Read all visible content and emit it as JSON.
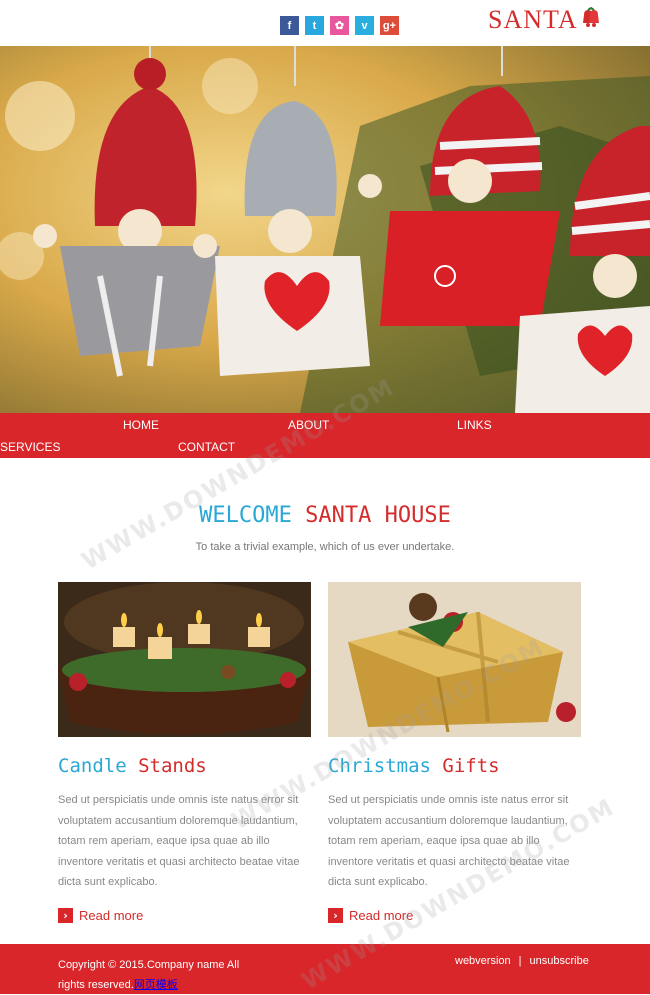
{
  "colors": {
    "accent_red": "#d8262a",
    "accent_blue": "#29a8d6"
  },
  "social": [
    {
      "icon": "facebook-icon",
      "glyph": "f",
      "color": "#3b5998"
    },
    {
      "icon": "twitter-icon",
      "glyph": "t",
      "color": "#29a8e0"
    },
    {
      "icon": "dribbble-icon",
      "glyph": "✿",
      "color": "#e8579b"
    },
    {
      "icon": "vimeo-icon",
      "glyph": "v",
      "color": "#2aaee0"
    },
    {
      "icon": "google-plus-icon",
      "glyph": "g+",
      "color": "#dd4b39"
    }
  ],
  "logo": {
    "text": "SANTA",
    "icon": "bells-icon"
  },
  "nav": {
    "home": "HOME",
    "about": "ABOUT",
    "links": "LINKS",
    "services": "SERVICES",
    "contact": "CONTACT"
  },
  "welcome": {
    "part1": "WELCOME",
    "part2": "SANTA HOUSE",
    "tagline": "To take a trivial example, which of us ever undertake."
  },
  "cards": [
    {
      "title_a": "Candle",
      "title_b": "Stands",
      "text": "Sed ut perspiciatis unde omnis iste natus error sit voluptatem accusantium doloremque laudantium, totam rem aperiam, eaque ipsa quae ab illo inventore veritatis et quasi architecto beatae vitae dicta sunt explicabo.",
      "read_more": "Read more"
    },
    {
      "title_a": "Christmas",
      "title_b": "Gifts",
      "text": "Sed ut perspiciatis unde omnis iste natus error sit voluptatem accusantium doloremque laudantium, totam rem aperiam, eaque ipsa quae ab illo inventore veritatis et quasi architecto beatae vitae dicta sunt explicabo.",
      "read_more": "Read more"
    }
  ],
  "footer": {
    "copyright": "Copyright © 2015.Company name All rights reserved.",
    "link": "网页模板",
    "webversion": "webversion",
    "sep": "|",
    "unsubscribe": "unsubscribe"
  },
  "watermark": "WWW.DOWNDEMO.COM"
}
